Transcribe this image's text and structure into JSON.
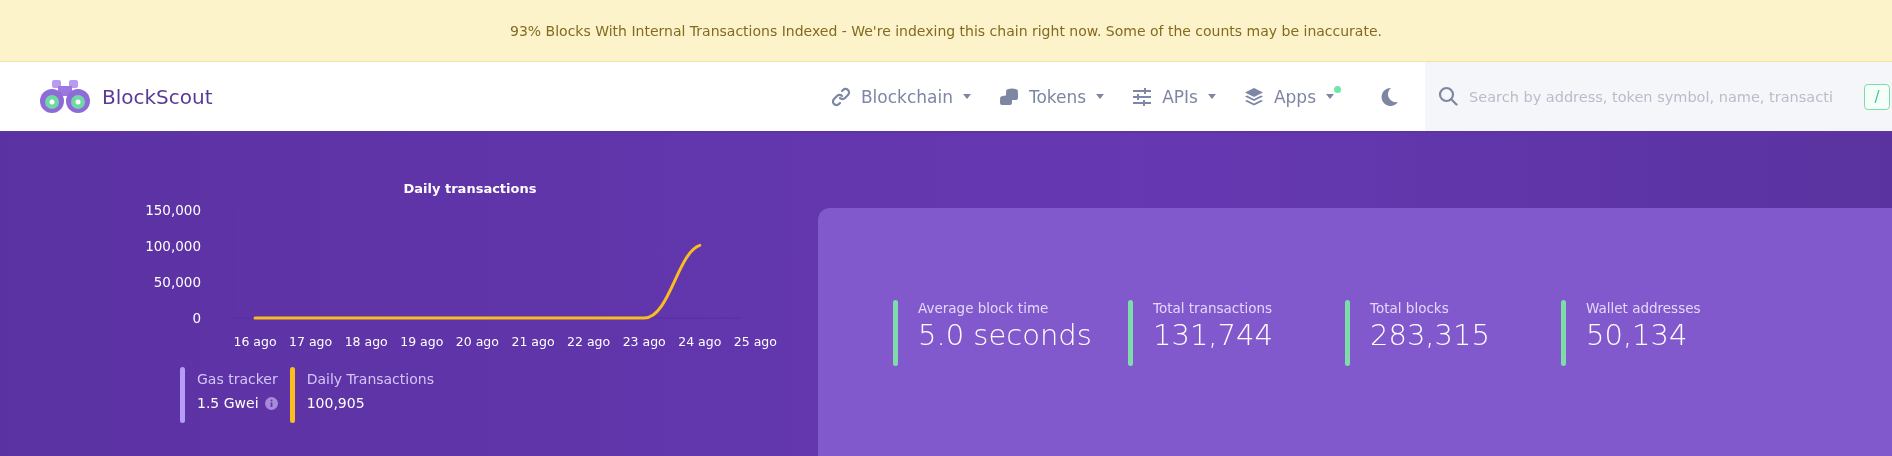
{
  "banner": {
    "text": "93% Blocks With Internal Transactions Indexed - We're indexing this chain right now. Some of the counts may be inaccurate."
  },
  "header": {
    "logo_text": "BlockScout",
    "nav": [
      {
        "label": "Blockchain",
        "kind": "link"
      },
      {
        "label": "Tokens",
        "kind": "coins"
      },
      {
        "label": "APIs",
        "kind": "sliders"
      },
      {
        "label": "Apps",
        "kind": "layers"
      }
    ],
    "status_dot": {
      "color": "#6ee7a8"
    },
    "search": {
      "placeholder": "Search by address, token symbol, name, transacti",
      "shortcut": "/"
    }
  },
  "chart": {
    "chart_data": {
      "type": "line",
      "title": "Daily transactions",
      "categories": [
        "16 ago",
        "17 ago",
        "18 ago",
        "19 ago",
        "20 ago",
        "21 ago",
        "22 ago",
        "23 ago",
        "24 ago",
        "25 ago"
      ],
      "ylim": [
        0,
        150000
      ],
      "yticks": [
        {
          "value": 0,
          "label": "0"
        },
        {
          "value": 50000,
          "label": "50,000"
        },
        {
          "value": 100000,
          "label": "100,000"
        },
        {
          "value": 150000,
          "label": "150,000"
        }
      ],
      "series": [
        {
          "color": "#f9bd21",
          "values": [
            0,
            0,
            0,
            0,
            0,
            0,
            0,
            0,
            100905,
            null
          ]
        }
      ]
    }
  },
  "legend": [
    {
      "label": "Gas tracker",
      "value": "1.5 Gwei",
      "color": "#b69cf5",
      "info": true
    },
    {
      "label": "Daily Transactions",
      "value": "100,905",
      "color": "#f9bd21",
      "info": false
    }
  ],
  "stats": [
    {
      "label": "Average block time",
      "value": "5.0 seconds"
    },
    {
      "label": "Total transactions",
      "value": "131,744"
    },
    {
      "label": "Total blocks",
      "value": "283,315"
    },
    {
      "label": "Wallet addresses",
      "value": "50,134"
    }
  ]
}
